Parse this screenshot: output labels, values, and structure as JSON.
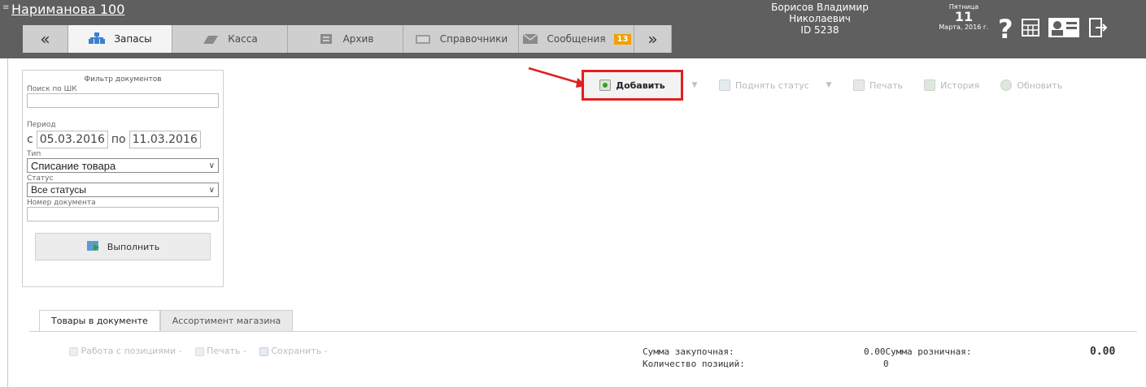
{
  "header": {
    "location": "Нариманова 100",
    "user_name": "Борисов Владимир Николаевич",
    "user_id": "ID 5238",
    "date": {
      "weekday": "Пятница",
      "day": "11",
      "month_year": "Марта, 2016 г."
    },
    "tabs": [
      {
        "label": "«",
        "icon": "nav-back-icon"
      },
      {
        "label": "Запасы",
        "icon": "stock-icon"
      },
      {
        "label": "Касса",
        "icon": "cash-icon"
      },
      {
        "label": "Архив",
        "icon": "archive-icon"
      },
      {
        "label": "Справочники",
        "icon": "directory-icon"
      },
      {
        "label": "Сообщения",
        "icon": "messages-icon",
        "badge": "13"
      },
      {
        "label": "»",
        "icon": "nav-forward-icon"
      }
    ],
    "icons": [
      "help-icon",
      "calendar-icon",
      "profile-icon",
      "exit-icon"
    ]
  },
  "toolbar": {
    "add": "Добавить",
    "raise_status": "Поднять статус",
    "print": "Печать",
    "history": "История",
    "refresh": "Обновить"
  },
  "filter": {
    "title": "Фильтр документов",
    "barcode_label": "Поиск по ШК",
    "barcode_value": "",
    "period_label": "Период",
    "from_prefix": "с",
    "from_date": "05.03.2016",
    "to_prefix": "по",
    "to_date": "11.03.2016",
    "type_label": "Тип",
    "type_value": "Списание товара",
    "status_label": "Статус",
    "status_value": "Все статусы",
    "doc_number_label": "Номер документа",
    "doc_number_value": "",
    "execute": "Выполнить"
  },
  "bottom": {
    "tabs": [
      "Товары в документе",
      "Ассортимент магазина"
    ],
    "tools": [
      "Работа с позициями -",
      "Печать -",
      "Сохранить -"
    ],
    "sum_purchase_label": "Сумма закупочная:",
    "sum_purchase_value": "0.00",
    "sum_retail_label": "Сумма розничная:",
    "sum_retail_value": "0.00",
    "positions_label": "Количество позиций:",
    "positions_value": "0"
  },
  "colors": {
    "header": "#5f5f5f",
    "highlight": "#e02020",
    "badge": "#f0a000"
  }
}
